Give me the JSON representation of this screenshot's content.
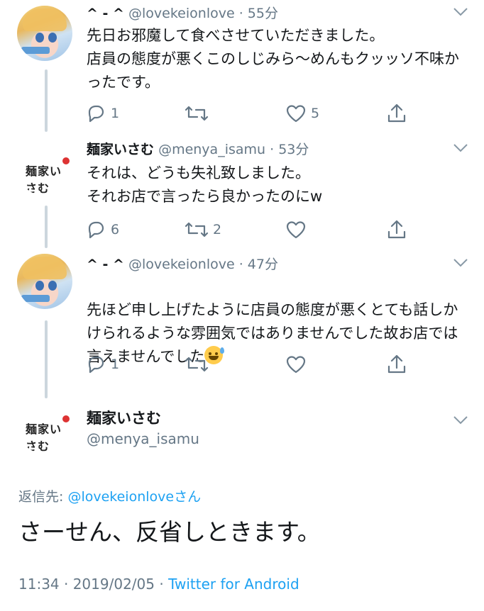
{
  "tweets": [
    {
      "name": "^ - ^",
      "handle": "@lovekeionlove",
      "time": "55分",
      "text": "先日お邪魔して食べさせていただきました。\n店員の態度が悪くこのしじみら〜めんもクッッソ不味かったです。",
      "reply_count": "1",
      "retweet_count": "",
      "like_count": "5",
      "avatar": "anime-avatar"
    },
    {
      "name": "麺家いさむ",
      "handle": "@menya_isamu",
      "time": "53分",
      "text": "それは、どうも失礼致しました。\nそれお店で言ったら良かったのにw",
      "reply_count": "6",
      "retweet_count": "2",
      "like_count": "",
      "avatar": "shop-logo-avatar"
    },
    {
      "name": "^ - ^",
      "handle": "@lovekeionlove",
      "time": "47分",
      "text": "先ほど申し上げたように店員の態度が悪くとても話しかけられるような雰囲気ではありませんでした故お店では言えませんでした",
      "reply_count": "1",
      "retweet_count": "",
      "like_count": "",
      "avatar": "anime-avatar",
      "emoji": "grinning-face-with-sweat"
    }
  ],
  "main_tweet": {
    "name": "麺家いさむ",
    "handle": "@menya_isamu",
    "reply_prefix": "返信先: ",
    "reply_target": "@lovekeionloveさん",
    "text": "さーせん、反省しときます。",
    "time": "11:34 · 2019/02/05 · ",
    "source": "Twitter for Android"
  },
  "logo_text": "麺家いさむ",
  "colors": {
    "link": "#1da1f2",
    "secondary": "#657786",
    "primary_text": "#14171a",
    "thread_line": "#ccd6dd"
  }
}
